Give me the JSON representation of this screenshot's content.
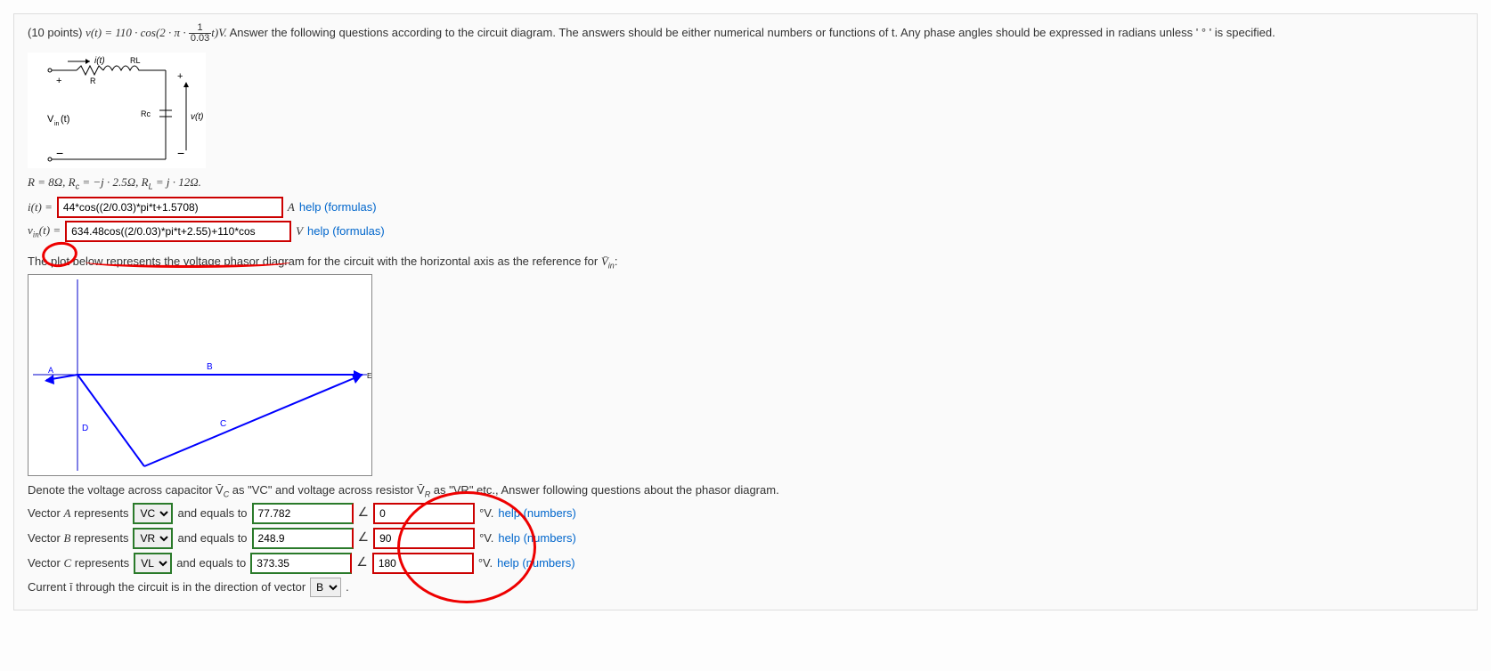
{
  "points_label": "(10 points)",
  "eq_prefix": "v(t) = 110 · cos(2 · π · ",
  "eq_frac_num": "1",
  "eq_frac_den": "0.03",
  "eq_suffix": "t)V.",
  "instructions": "Answer the following questions according to the circuit diagram. The answers should be either numerical numbers or functions of t. Any phase angles should be expressed in radians unless ' ° ' is specified.",
  "circuit_labels": {
    "it": "i(t)",
    "RL": "RL",
    "R": "R",
    "plus": "+",
    "Vin": "V",
    "Vin_sub": "in",
    "Vin_t": "(t)",
    "Rc": "Rc",
    "vt": "v(t)",
    "minus": "−"
  },
  "params": "R = 8Ω, R",
  "params_c_sub": "c",
  "params_mid": " = −j · 2.5Ω, R",
  "params_L_sub": "L",
  "params_end": " = j · 12Ω.",
  "row_it": {
    "label_pre": "i(t) = ",
    "value": "44*cos((2/0.03)*pi*t+1.5708)",
    "unit": "A",
    "help": "help (formulas)"
  },
  "row_vin": {
    "label_pre_base": "v",
    "label_sub": "in",
    "label_post": "(t) = ",
    "value": "634.48cos((2/0.03)*pi*t+2.55)+110*cos",
    "unit": "V",
    "help": "help (formulas)"
  },
  "plot_text_pre": "The plot below represents the voltage phasor diagram for the circuit with the horizontal axis as the reference for ",
  "plot_text_vin": "V̄",
  "plot_text_vin_sub": "in",
  "plot_text_post": ":",
  "phasor_labels": {
    "A": "A",
    "B": "B",
    "C": "C",
    "D": "D",
    "E": "E"
  },
  "denote_text": "Denote the voltage across capacitor V̄",
  "denote_C_sub": "C",
  "denote_mid": " as \"VC\" and voltage across resistor V̄",
  "denote_R_sub": "R",
  "denote_end": " as \"VR\" etc., Answer following questions about the phasor diagram.",
  "vectors": [
    {
      "name": "A",
      "represents": "VC",
      "equals_label": " and equals to ",
      "mag": "77.782",
      "angle": "0",
      "unit": "°V.",
      "help": "help (numbers)"
    },
    {
      "name": "B",
      "represents": "VR",
      "equals_label": " and equals to ",
      "mag": "248.9",
      "angle": "90",
      "unit": "°V.",
      "help": "help (numbers)"
    },
    {
      "name": "C",
      "represents": "VL",
      "equals_label": " and equals to ",
      "mag": "373.35",
      "angle": "180",
      "unit": "°V.",
      "help": "help (numbers)"
    }
  ],
  "represents_label": " represents ",
  "vector_label": "Vector ",
  "current_text_pre": "Current ī through the circuit is in the direction of vector ",
  "current_select": "B",
  "select_options": [
    "VC",
    "VR",
    "VL",
    "VIN"
  ],
  "dir_options": [
    "A",
    "B",
    "C",
    "D",
    "E"
  ]
}
